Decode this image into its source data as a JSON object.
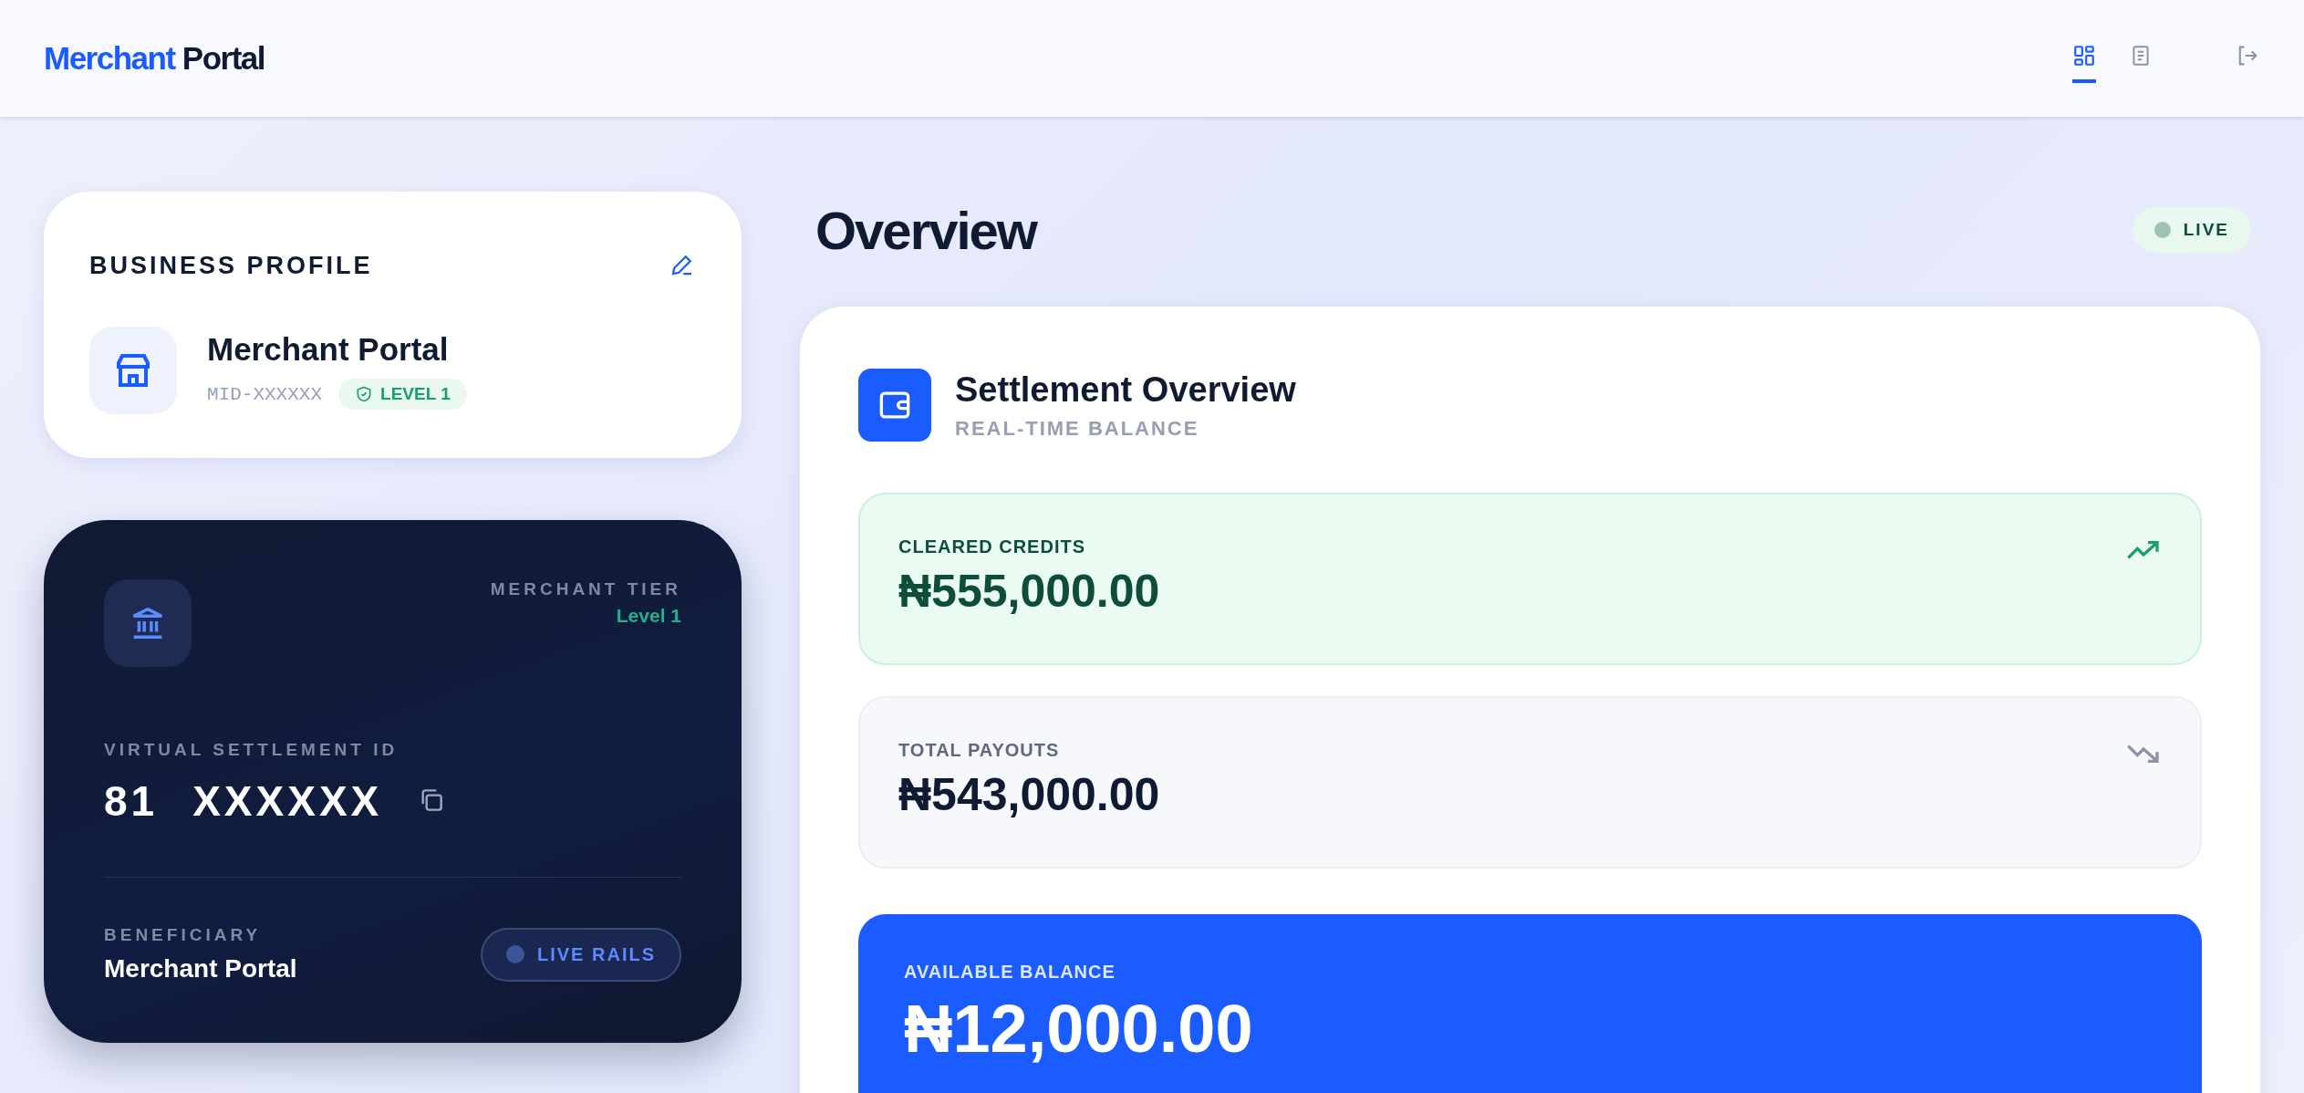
{
  "header": {
    "logo": {
      "accent": "Merchant",
      "rest": "Portal"
    },
    "nav": [
      {
        "kind": "dashboard",
        "selected": true
      },
      {
        "kind": "document",
        "selected": false
      },
      {
        "kind": "logout",
        "selected": false
      }
    ]
  },
  "profile": {
    "title": "BUSINESS PROFILE",
    "name": "Merchant Portal",
    "mid": "MID-XXXXXX",
    "badge": "LEVEL 1"
  },
  "account_card": {
    "tier_label": "MERCHANT TIER",
    "tier": "Level 1",
    "id_label": "VIRTUAL SETTLEMENT ID",
    "id_prefix": "81",
    "id_value": "XXXXXX",
    "beneficiary_label": "BENEFICIARY",
    "beneficiary": "Merchant Portal",
    "rails": "LIVE RAILS"
  },
  "overview": {
    "title": "Overview",
    "status": "LIVE"
  },
  "settlement": {
    "title": "Settlement Overview",
    "subtitle": "REAL-TIME BALANCE",
    "stats": [
      {
        "kind": "credit",
        "label": "CLEARED CREDITS",
        "amount": "₦555,000.00"
      },
      {
        "kind": "payout",
        "label": "TOTAL PAYOUTS",
        "amount": "₦543,000.00"
      },
      {
        "kind": "balance",
        "label": "AVAILABLE BALANCE",
        "amount": "₦12,000.00"
      }
    ]
  }
}
